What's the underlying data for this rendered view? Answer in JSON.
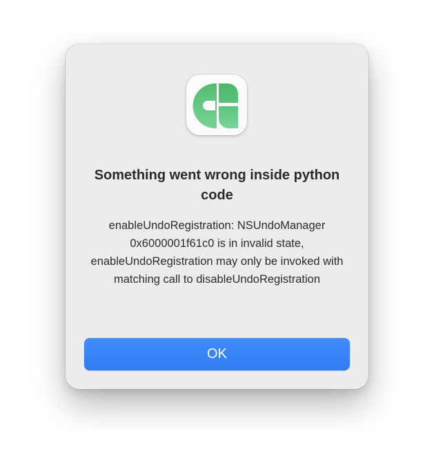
{
  "dialog": {
    "icon": "green-shapes-app-icon",
    "title": "Something went wrong inside python code",
    "message": "enableUndoRegistration: NSUndoManager 0x6000001f61c0 is in invalid state, enableUndoRegistration may only be invoked with matching call to disableUndoRegistration",
    "ok_label": "OK"
  },
  "colors": {
    "button": "#3486f8",
    "icon_green_light": "#6ccb86",
    "icon_green_dark": "#46b765",
    "dialog_background": "#ececec"
  }
}
